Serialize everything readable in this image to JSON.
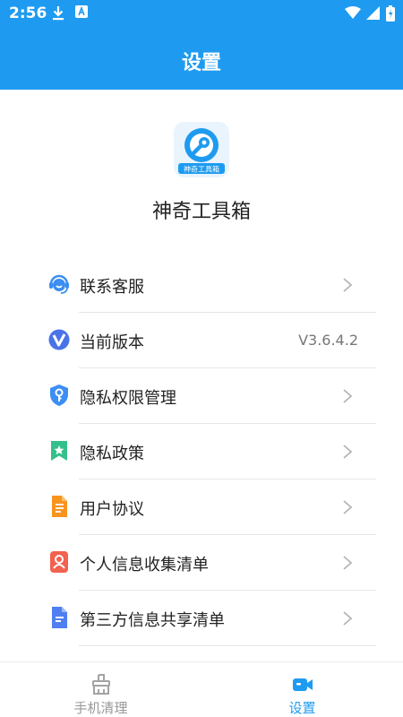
{
  "status_bar": {
    "time": "2:56"
  },
  "header": {
    "title": "设置"
  },
  "app": {
    "logo_text": "神奇工具箱",
    "name": "神奇工具箱"
  },
  "menu": [
    {
      "label": "联系客服",
      "icon": "customer-service-icon",
      "value": null
    },
    {
      "label": "当前版本",
      "icon": "version-icon",
      "value": "V3.6.4.2"
    },
    {
      "label": "隐私权限管理",
      "icon": "shield-key-icon",
      "value": null
    },
    {
      "label": "隐私政策",
      "icon": "bookmark-star-icon",
      "value": null
    },
    {
      "label": "用户协议",
      "icon": "document-icon",
      "value": null
    },
    {
      "label": "个人信息收集清单",
      "icon": "person-card-icon",
      "value": null
    },
    {
      "label": "第三方信息共享清单",
      "icon": "file-list-icon",
      "value": null
    }
  ],
  "bottom_nav": {
    "items": [
      {
        "label": "手机清理",
        "icon": "broom-icon",
        "active": false
      },
      {
        "label": "设置",
        "icon": "video-camera-icon",
        "active": true
      }
    ]
  },
  "colors": {
    "primary": "#1e9bf0",
    "text": "#222222",
    "muted": "#777777",
    "inactive": "#999999"
  }
}
